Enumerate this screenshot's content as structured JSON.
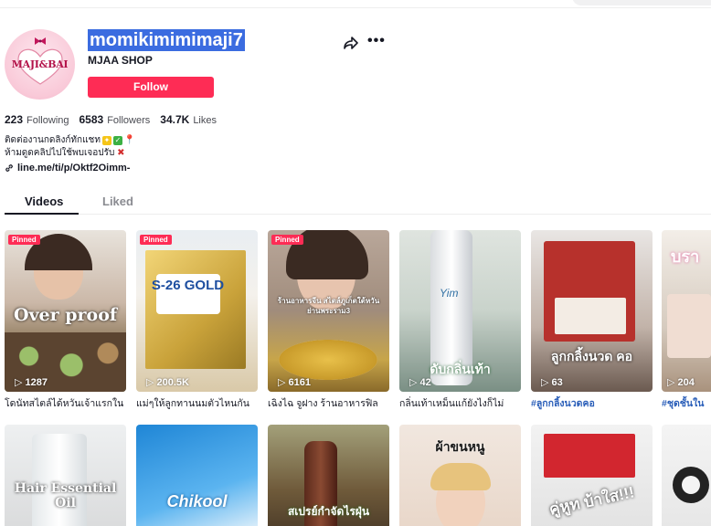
{
  "profile": {
    "username": "momikimimimaji7",
    "nickname": "MJAA SHOP",
    "avatar_text": "MAJI&BAI",
    "follow_label": "Follow",
    "stats": {
      "following_count": "223",
      "following_label": "Following",
      "followers_count": "6583",
      "followers_label": "Followers",
      "likes_count": "34.7K",
      "likes_label": "Likes"
    },
    "bio_line1": "ติดต่องานกดลิงก์ทักแชท",
    "bio_line2": "ห้ามดูดคลิปไปใช้พบเจอปรับ",
    "link": "line.me/ti/p/Oktf2Oimm-"
  },
  "tabs": [
    {
      "label": "Videos",
      "active": true
    },
    {
      "label": "Liked",
      "active": false
    }
  ],
  "videos_row1": [
    {
      "pinned": "Pinned",
      "views": "1287",
      "caption": "โดนัทสไตล์ได้หวันเจ้าแรกใน",
      "overlay": "Over proof",
      "tag": false
    },
    {
      "pinned": "Pinned",
      "views": "200.5K",
      "caption": "แม่ๆให้ลูกทานนมตัวไหนกัน",
      "overlay": "S-26 GOLD",
      "tag": false
    },
    {
      "pinned": "Pinned",
      "views": "6161",
      "caption": "เฉิงไฉ จูฝาง ร้านอาหารฟิล",
      "overlay": "ร้านอาหารจีน สไตล์ภูเก็ตใต้หวัน ย่านพระราม3",
      "tag": false
    },
    {
      "pinned": "",
      "views": "42",
      "caption": "กลิ่นเท้าเหม็นแก้ยังไงก็ไม่",
      "overlay": "ดับกลิ่นเท้า",
      "tag": false
    },
    {
      "pinned": "",
      "views": "63",
      "caption": "#ลูกกลิ้งนวดคอ",
      "overlay": "ลูกกลิ้งนวด คอ",
      "tag": true
    },
    {
      "pinned": "",
      "views": "204",
      "caption": "#ชุดชั้นใน",
      "overlay": "บรา",
      "tag": true
    }
  ],
  "videos_row2": [
    {
      "overlay": "Hair Essential Oil"
    },
    {
      "overlay": "Chikool"
    },
    {
      "overlay": "สเปรย์กำจัดไรฝุ่น"
    },
    {
      "overlay": "ผ้าขนหนู"
    },
    {
      "overlay": "คู่หูท บ้าใส!!!"
    },
    {
      "overlay": ""
    }
  ],
  "colors": {
    "accent": "#fe2c55",
    "username_highlight": "#3b6ce0",
    "hashtag": "#2b5fb9"
  }
}
